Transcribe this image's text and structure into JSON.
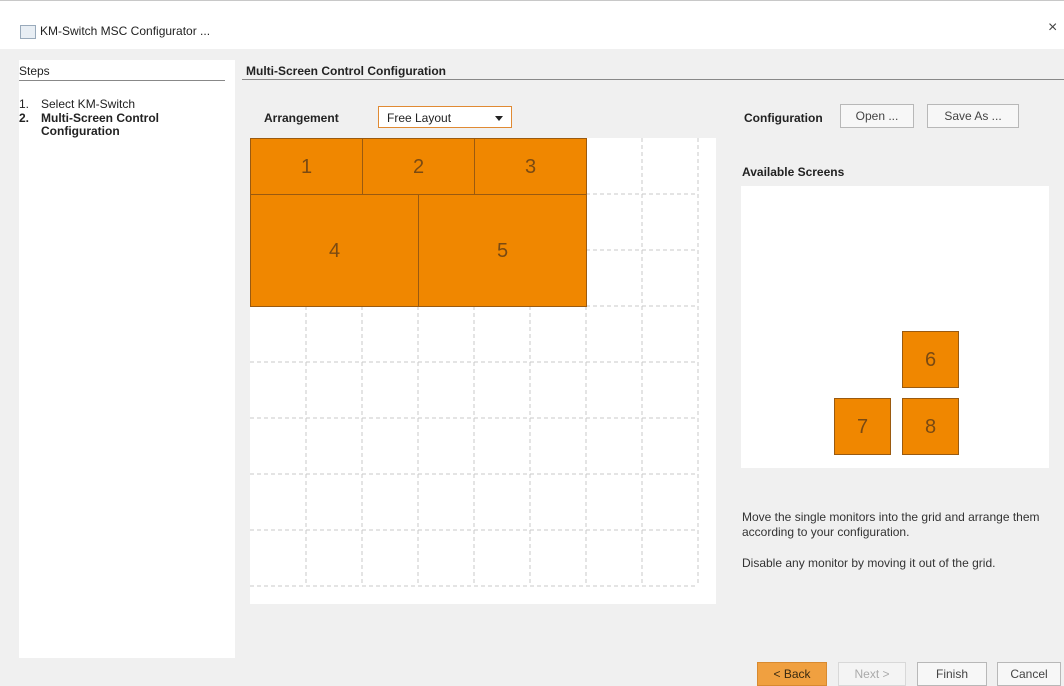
{
  "window": {
    "title": "KM-Switch MSC Configurator ...",
    "close_glyph": "×"
  },
  "steps": {
    "title": "Steps",
    "items": [
      {
        "num": "1.",
        "label": "Select KM-Switch"
      },
      {
        "num": "2.",
        "label": "Multi-Screen Control Configuration"
      }
    ]
  },
  "section": {
    "title": "Multi-Screen Control Configuration"
  },
  "arrangement": {
    "label": "Arrangement",
    "selected": "Free Layout"
  },
  "configuration": {
    "label": "Configuration",
    "open_label": "Open ...",
    "save_label": "Save As ..."
  },
  "grid_monitors": [
    "1",
    "2",
    "3",
    "4",
    "5"
  ],
  "available": {
    "title": "Available Screens",
    "monitors": [
      "6",
      "7",
      "8"
    ]
  },
  "hints": {
    "line1": "Move the single monitors into the grid and arrange them according to your configuration.",
    "line2": "Disable any monitor by moving it out of the grid."
  },
  "footer": {
    "back_label": "< Back",
    "next_label": "Next >",
    "finish_label": "Finish",
    "cancel_label": "Cancel"
  },
  "colors": {
    "monitor": "#f08700",
    "accent": "#f0a040"
  }
}
